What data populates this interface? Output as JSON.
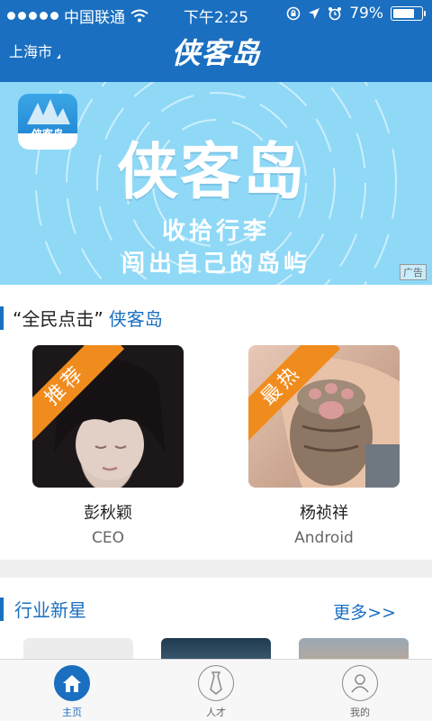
{
  "status_bar": {
    "carrier": "中国联通",
    "time": "下午2:25",
    "battery": "79%",
    "battery_level": 0.79,
    "icons": [
      "signal-dots-icon",
      "wifi-icon",
      "rotation-lock-icon",
      "location-arrow-icon",
      "alarm-icon",
      "battery-icon"
    ]
  },
  "header": {
    "city": "上海市",
    "logo": "侠客岛"
  },
  "banner": {
    "app_icon_label": "侠客岛",
    "title": "侠客岛",
    "line1": "收拾行李",
    "line2": "闯出自己的岛屿",
    "ad_label": "广告",
    "color": "#8fd9f7"
  },
  "section_featured": {
    "title_quote": "“全民点击”",
    "title_brand": "侠客岛",
    "people": [
      {
        "ribbon": "推荐",
        "name": "彭秋颖",
        "role": "CEO"
      },
      {
        "ribbon": "最热",
        "name": "杨祯祥",
        "role": "Android"
      }
    ]
  },
  "section_stars": {
    "title": "行业新星",
    "more": "更多>>"
  },
  "tabbar": {
    "tabs": [
      {
        "label": "主页",
        "icon": "home-icon",
        "active": true
      },
      {
        "label": "人才",
        "icon": "tie-icon",
        "active": false
      },
      {
        "label": "我的",
        "icon": "user-icon",
        "active": false
      }
    ]
  },
  "colors": {
    "brand": "#1a6fc0",
    "ribbon": "#f08c1e"
  }
}
